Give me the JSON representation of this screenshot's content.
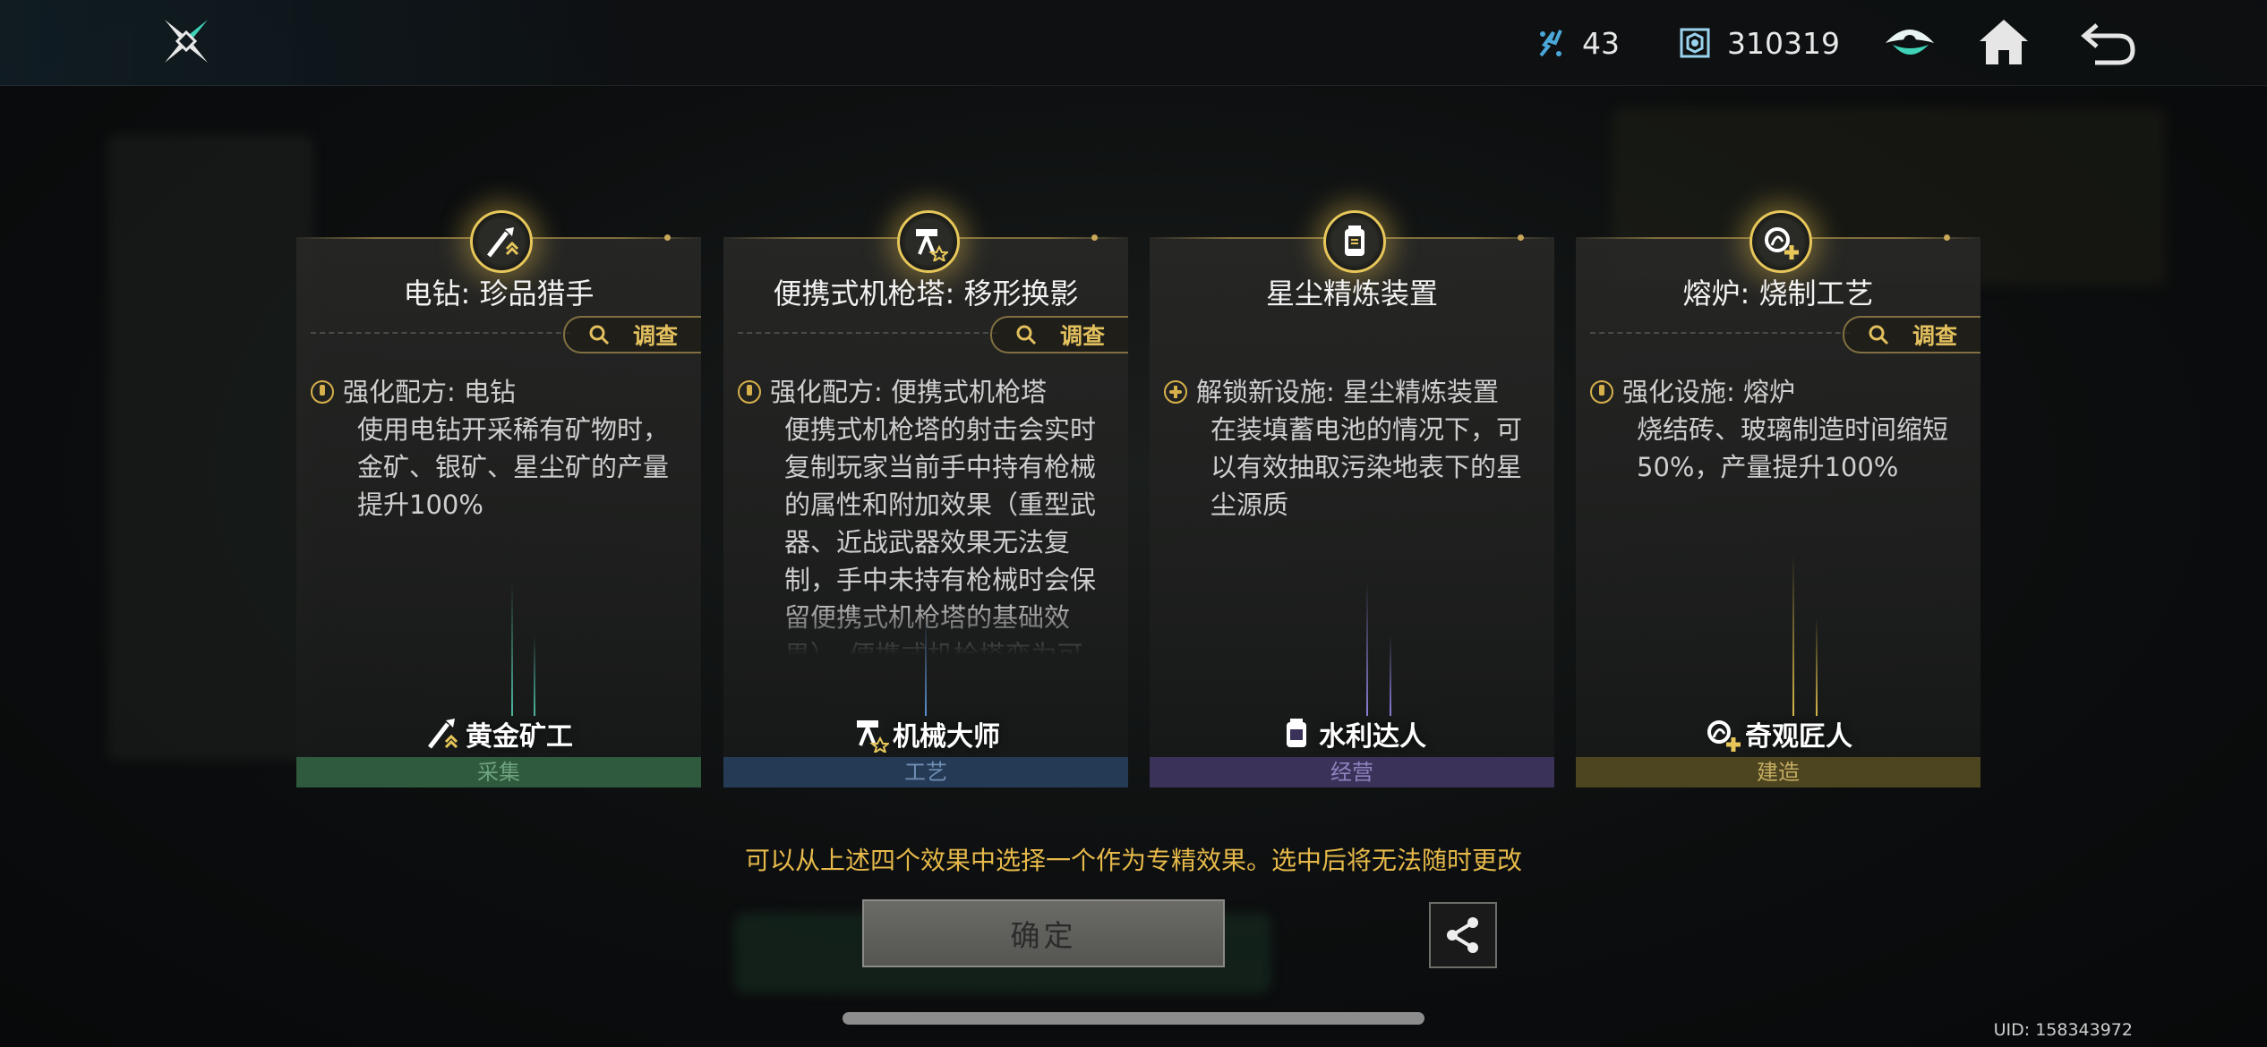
{
  "header": {
    "resources": [
      {
        "icon": "crystal-icon",
        "value": "43"
      },
      {
        "icon": "token-icon",
        "value": "310319"
      }
    ]
  },
  "cards": [
    {
      "title": "电钻: 珍品猎手",
      "investigate_label": "调查",
      "bullet": "upgrade",
      "heading": "强化配方: 电钻",
      "body": "使用电钻开采稀有矿物时，金矿、银矿、星尘矿的产量提升100%",
      "role": "黄金矿工",
      "category": "采集",
      "category_color": "#2f5a3e",
      "category_text_color": "#6fa37e",
      "beam_color": "#4fb7a0"
    },
    {
      "title": "便携式机枪塔: 移形换影",
      "investigate_label": "调查",
      "bullet": "upgrade",
      "heading": "强化配方: 便携式机枪塔",
      "body": "便携式机枪塔的射击会实时复制玩家当前手中持有枪械的属性和附加效果（重型武器、近战武器效果无法复制，手中未持有枪械时会保留便携式机枪塔的基础效果）。便携式机枪塔变为可",
      "role": "机械大师",
      "category": "工艺",
      "category_color": "#253a55",
      "category_text_color": "#6f8fb3",
      "beam_color": "#5c8fd0"
    },
    {
      "title": "星尘精炼装置",
      "investigate_label": "",
      "bullet": "new",
      "heading": "解锁新设施: 星尘精炼装置",
      "body": "在装填蓄电池的情况下，可以有效抽取污染地表下的星尘源质",
      "role": "水利达人",
      "category": "经营",
      "category_color": "#3a3258",
      "category_text_color": "#8e84c0",
      "beam_color": "#8a7fd8"
    },
    {
      "title": "熔炉: 烧制工艺",
      "investigate_label": "调查",
      "bullet": "upgrade",
      "heading": "强化设施: 熔炉",
      "body": "烧结砖、玻璃制造时间缩短50%，产量提升100%",
      "role": "奇观匠人",
      "category": "建造",
      "category_color": "#4d4420",
      "category_text_color": "#c4ad62",
      "beam_color": "#d7b84a"
    }
  ],
  "notice": "可以从上述四个效果中选择一个作为专精效果。选中后将无法随时更改",
  "confirm_label": "确定",
  "uid": "UID: 158343972"
}
